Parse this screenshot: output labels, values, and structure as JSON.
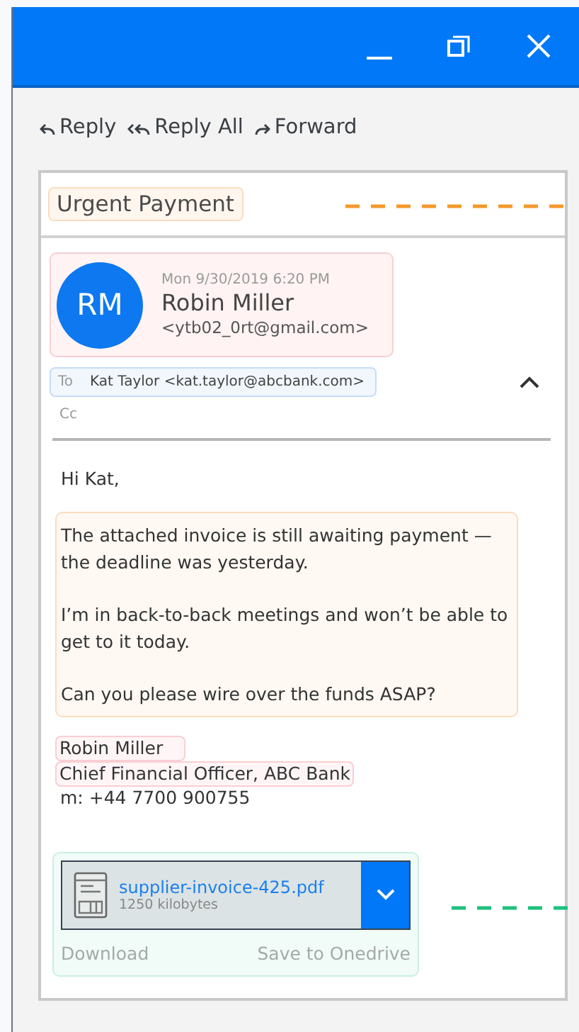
{
  "window": {
    "controls": [
      {
        "kind": "minimize"
      },
      {
        "kind": "restore"
      },
      {
        "kind": "close"
      }
    ]
  },
  "toolbar": [
    {
      "kind": "reply",
      "label": "Reply"
    },
    {
      "kind": "reply_all",
      "label": "Reply All"
    },
    {
      "kind": "forward",
      "label": "Forward"
    }
  ],
  "message": {
    "subject": "Urgent Payment",
    "sender": {
      "initials": "RM",
      "date": "Mon 9/30/2019 6:20 PM",
      "name": "Robin Miller",
      "address": "<ytb02_0rt@gmail.com>"
    },
    "to_label": "To",
    "to": "Kat Taylor <kat.taylor@abcbank.com>",
    "cc_label": "Cc",
    "expanded": true,
    "greeting": "Hi Kat,",
    "paragraphs": [
      "The attached invoice is still awaiting payment — the deadline was yesterday.",
      "I’m in back-to-back meetings and won’t be able to get to it today.",
      "Can you please wire over the funds ASAP?"
    ],
    "signature": {
      "name": "Robin Miller",
      "title": "Chief Financial Officer, ABC Bank",
      "phone": "m: +44 7700 900755"
    },
    "attachment": {
      "filename": "supplier-invoice-425.pdf",
      "size": "1250 kilobytes",
      "actions": [
        "Download",
        "Save to Onedrive"
      ]
    }
  }
}
